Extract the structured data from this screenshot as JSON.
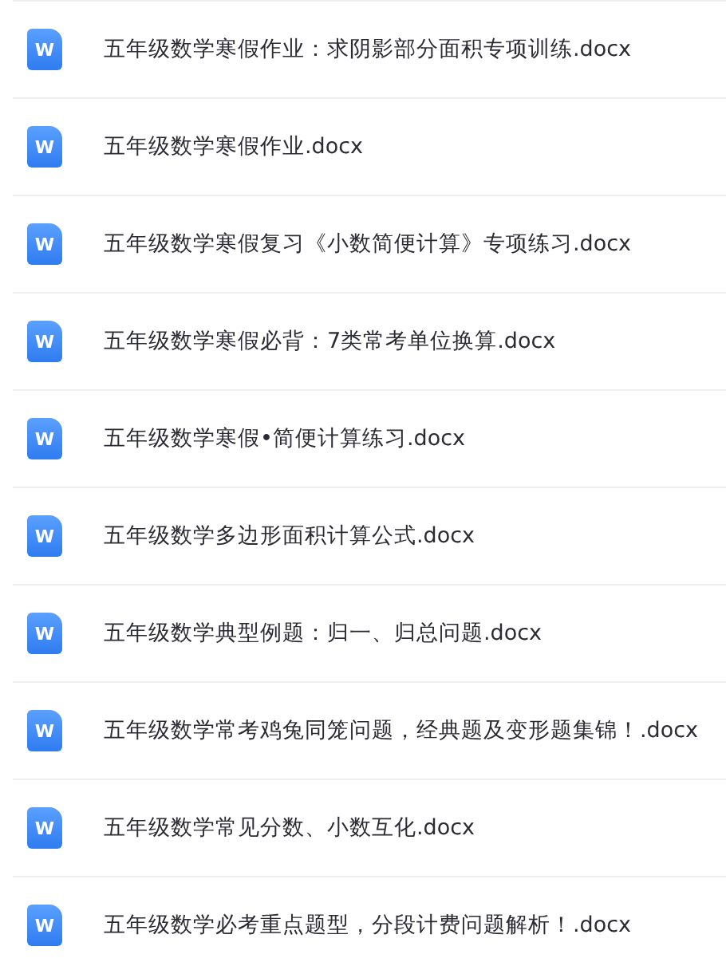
{
  "files": [
    {
      "icon_label": "W",
      "name": "五年级数学寒假作业：求阴影部分面积专项训练.docx"
    },
    {
      "icon_label": "W",
      "name": "五年级数学寒假作业.docx"
    },
    {
      "icon_label": "W",
      "name": "五年级数学寒假复习《小数简便计算》专项练习.docx"
    },
    {
      "icon_label": "W",
      "name": "五年级数学寒假必背：7类常考单位换算.docx"
    },
    {
      "icon_label": "W",
      "name": "五年级数学寒假•简便计算练习.docx"
    },
    {
      "icon_label": "W",
      "name": "五年级数学多边形面积计算公式.docx"
    },
    {
      "icon_label": "W",
      "name": "五年级数学典型例题：归一、归总问题.docx"
    },
    {
      "icon_label": "W",
      "name": "五年级数学常考鸡兔同笼问题，经典题及变形题集锦！.docx"
    },
    {
      "icon_label": "W",
      "name": "五年级数学常见分数、小数互化.docx"
    },
    {
      "icon_label": "W",
      "name": "五年级数学必考重点题型，分段计费问题解析！.docx"
    }
  ]
}
